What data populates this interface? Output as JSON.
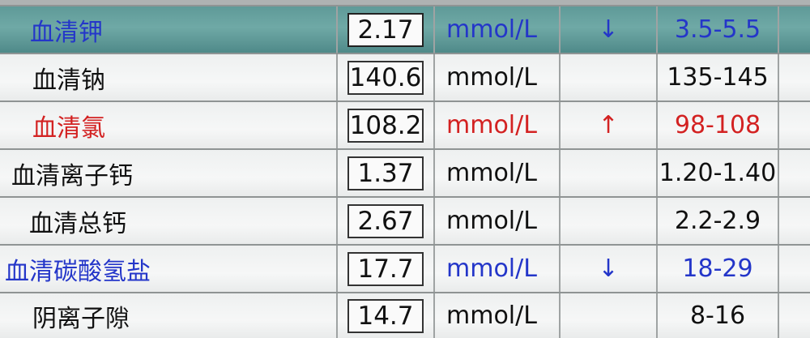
{
  "rows": [
    {
      "name": "血清钾",
      "value": "2.17",
      "unit": "mmol/L",
      "flag": "↓",
      "range": "3.5-5.5"
    },
    {
      "name": "血清钠",
      "value": "140.6",
      "unit": "mmol/L",
      "flag": "",
      "range": "135-145"
    },
    {
      "name": "血清氯",
      "value": "108.2",
      "unit": "mmol/L",
      "flag": "↑",
      "range": "98-108"
    },
    {
      "name": "血清离子钙",
      "value": "1.37",
      "unit": "mmol/L",
      "flag": "",
      "range": "1.20-1.40"
    },
    {
      "name": "血清总钙",
      "value": "2.67",
      "unit": "mmol/L",
      "flag": "",
      "range": "2.2-2.9"
    },
    {
      "name": "血清碳酸氢盐",
      "value": "17.7",
      "unit": "mmol/L",
      "flag": "↓",
      "range": "18-29"
    },
    {
      "name": "阴离子隙",
      "value": "14.7",
      "unit": "mmol/L",
      "flag": "",
      "range": "8-16"
    }
  ],
  "colors": {
    "low": "#2436c9",
    "high": "#d32222",
    "normal": "#111111",
    "selected_row_bg": "#6fa9a6"
  }
}
